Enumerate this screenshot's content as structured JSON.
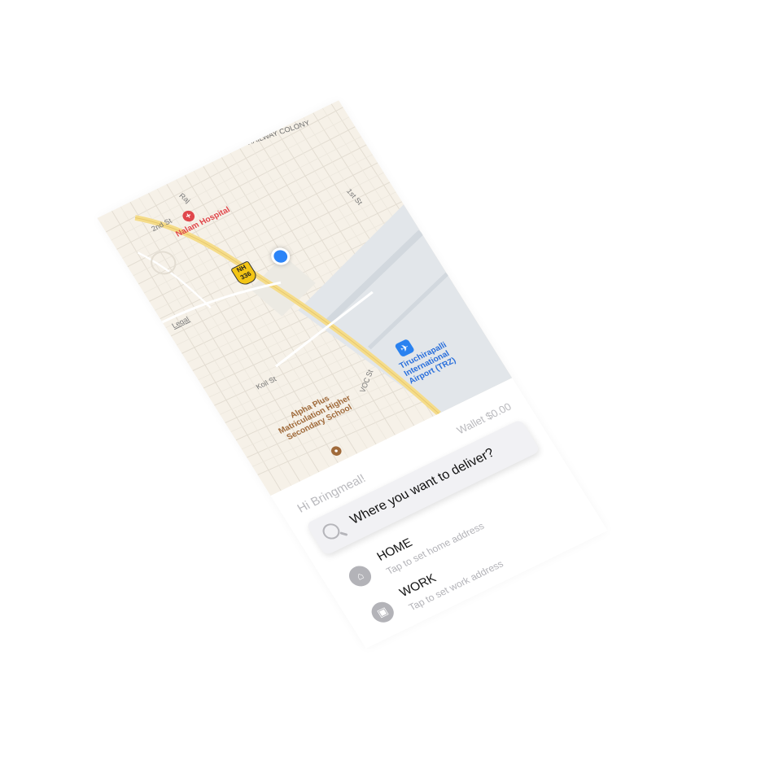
{
  "map": {
    "area_labels": {
      "railway_colony": "RAILWAY COLONY",
      "hospital": "Nalam Hospital",
      "street_2nd": "2nd St",
      "street_raj": "Raj",
      "street_1st": "1st St",
      "legal": "Legal",
      "koil_st": "Koil St",
      "voc_st": "VOC St",
      "school": "Alpha Plus Matriculation Higher Secondary School",
      "airport": "Tiruchirapalli International Airport (TRZ)",
      "highway_shield_top": "NH",
      "highway_shield_num": "336"
    },
    "hospital_icon": "cross-icon",
    "airport_icon": "airplane-icon",
    "school_icon": "school-icon"
  },
  "panel": {
    "greeting": "Hi Bringmeal!",
    "wallet": "Wallet $0.00",
    "search": {
      "icon": "search-icon",
      "placeholder": "Where you want to deliver?"
    },
    "addresses": [
      {
        "icon": "home-icon",
        "title": "HOME",
        "subtitle": "Tap to set home address"
      },
      {
        "icon": "briefcase-icon",
        "title": "WORK",
        "subtitle": "Tap to set work address"
      }
    ]
  },
  "colors": {
    "map_land": "#f6f1e8",
    "water_airport": "#e2e6ea",
    "location_dot": "#2c84f7",
    "hospital": "#e0474c",
    "airport": "#2a6fdb",
    "highway_shield": "#f3c515"
  }
}
